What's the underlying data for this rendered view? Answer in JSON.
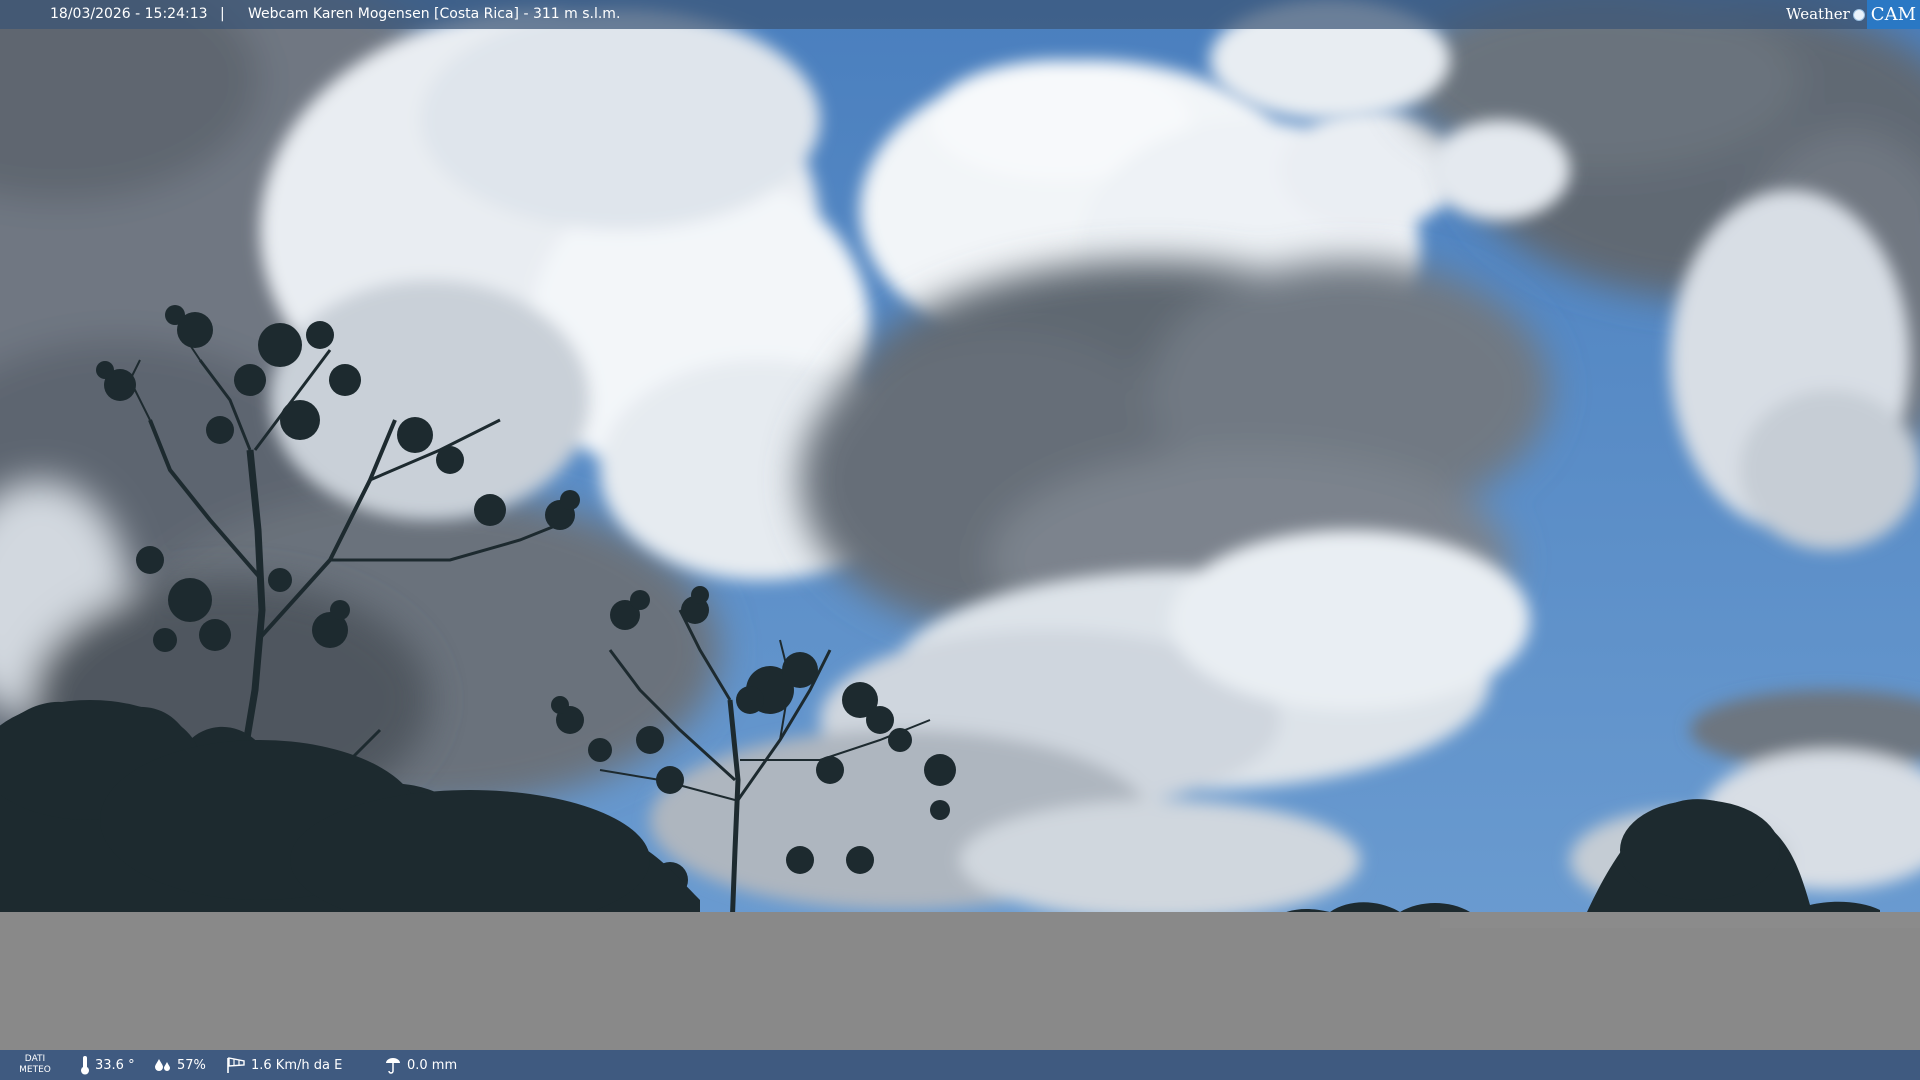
{
  "header": {
    "datetime": "18/03/2026 - 15:24:13",
    "separator": "|",
    "caption": "Webcam Karen Mogensen [Costa Rica]  - 311 m s.l.m."
  },
  "logo": {
    "weather_text": "Weather",
    "cam_text": "CAM",
    "accent_color": "#2a78c4"
  },
  "footer": {
    "meteo_label_line1": "DATI",
    "meteo_label_line2": "METEO",
    "temperature": "33.6 °",
    "humidity": "57%",
    "wind": "1.6 Km/h da E",
    "rain": "0.0 mm",
    "icons": {
      "temperature": "thermometer-icon",
      "humidity": "humidity-drops-icon",
      "wind": "wind-sock-icon",
      "rain": "rain-gauge-icon"
    },
    "bar_color": "#3f5a80"
  },
  "colors": {
    "sky_blue": "#4a7fbe",
    "cloud_white": "#eef2f6",
    "cloud_shadow": "#5e6670",
    "tree_silhouette": "#1d2a2f",
    "no_signal_gray": "#898989"
  }
}
